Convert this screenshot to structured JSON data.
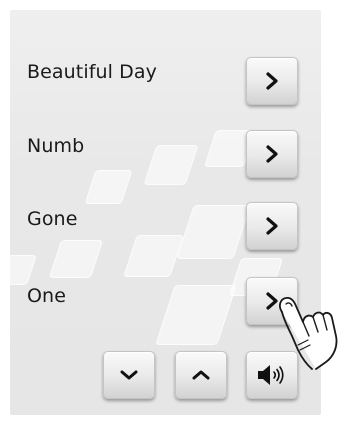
{
  "songs": [
    {
      "title": "Beautiful Day"
    },
    {
      "title": "Numb"
    },
    {
      "title": "Gone"
    },
    {
      "title": "One"
    }
  ],
  "controls": {
    "scroll_down_icon": "chevron-down-icon",
    "scroll_up_icon": "chevron-up-icon",
    "volume_icon": "speaker-volume-icon"
  },
  "colors": {
    "panel_background": "#e8e8e8",
    "button_face": "#e9e9e9",
    "text": "#1a1a1a",
    "icon": "#111111"
  }
}
